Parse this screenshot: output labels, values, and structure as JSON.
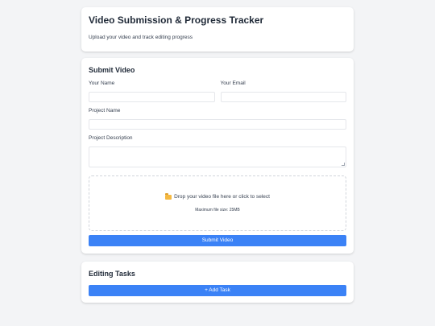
{
  "header": {
    "title": "Video Submission & Progress Tracker",
    "subtitle": "Upload your video and track editing progress"
  },
  "submit": {
    "heading": "Submit Video",
    "name_label": "Your Name",
    "email_label": "Your Email",
    "project_name_label": "Project Name",
    "project_description_label": "Project Description",
    "dropzone": {
      "icon": "folder-icon",
      "text": "Drop your video file here or click to select",
      "max_size": "Maximum file size: 25MB"
    },
    "submit_label": "Submit Video"
  },
  "tasks": {
    "heading": "Editing Tasks",
    "add_label": "+ Add Task"
  },
  "colors": {
    "accent": "#3b82f6",
    "background": "#f3f4f6",
    "card": "#ffffff"
  }
}
